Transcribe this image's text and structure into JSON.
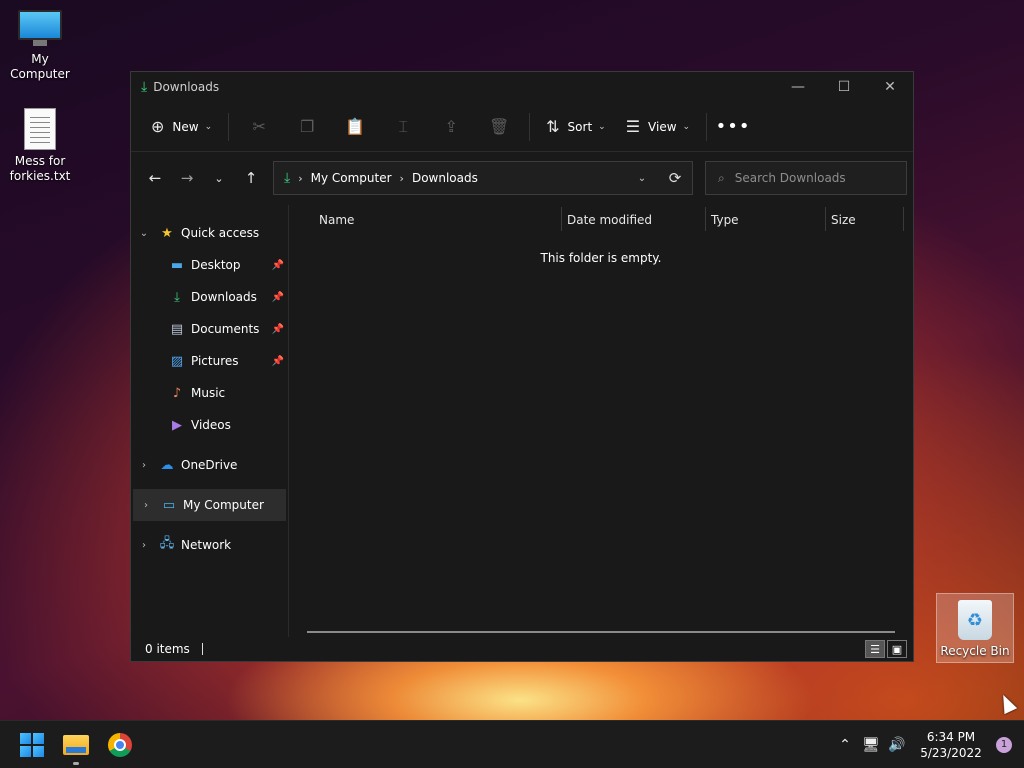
{
  "desktop": {
    "icons": [
      {
        "label": "My Computer"
      },
      {
        "label": "Mess for forkies.txt"
      }
    ],
    "recycle_bin": "Recycle Bin"
  },
  "window": {
    "title": "Downloads",
    "toolbar": {
      "new_label": "New",
      "sort_label": "Sort",
      "view_label": "View"
    },
    "address": {
      "crumbs": [
        "My Computer",
        "Downloads"
      ]
    },
    "search": {
      "placeholder": "Search Downloads"
    },
    "sidebar": {
      "quick_access": "Quick access",
      "pinned": [
        "Desktop",
        "Downloads",
        "Documents",
        "Pictures"
      ],
      "unpinned": [
        "Music",
        "Videos"
      ],
      "onedrive": "OneDrive",
      "my_computer": "My Computer",
      "network": "Network"
    },
    "columns": [
      "Name",
      "Date modified",
      "Type",
      "Size"
    ],
    "empty_message": "This folder is empty.",
    "status": {
      "items": "0 items"
    }
  },
  "taskbar": {
    "time": "6:34 PM",
    "date": "5/23/2022",
    "notification_count": "1"
  },
  "colors": {
    "accent_download": "#3ed07e",
    "window_bg": "#191919",
    "selected_bg": "#2d2d2d"
  }
}
